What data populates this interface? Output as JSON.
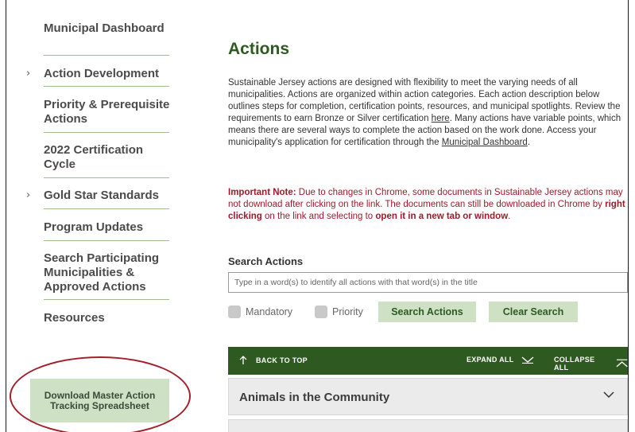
{
  "sidebar": {
    "items": [
      {
        "label": "Municipal Dashboard",
        "has_chevron": false
      },
      {
        "label": "Action Development",
        "has_chevron": true
      },
      {
        "label": "Priority & Prerequisite Actions",
        "has_chevron": false
      },
      {
        "label": "2022 Certification Cycle",
        "has_chevron": false
      },
      {
        "label": "Gold Star Standards",
        "has_chevron": true
      },
      {
        "label": "Program Updates",
        "has_chevron": false
      },
      {
        "label": "Search Participating Municipalities & Approved Actions",
        "has_chevron": false
      },
      {
        "label": "Resources",
        "has_chevron": false
      }
    ],
    "chevron_glyph": "›",
    "download_button": "Download Master Action Tracking Spreadsheet"
  },
  "main": {
    "title": "Actions",
    "intro": {
      "part1": "Sustainable Jersey actions are designed with flexibility to meet the varying needs of all municipalities. Actions are organized within action categories.  Each action description below outlines steps for completion, certification points, resources, and municipal spotlights.  Review the requirements to earn Bronze or Silver certification ",
      "link1": "here",
      "part2": ".  Many actions have variable points, which means there are several ways to complete the action based on the work done. Access your municipality's application for certification through the ",
      "link2": "Municipal Dashboard",
      "part3": "."
    },
    "note": {
      "label": "Important Note:",
      "part1": " Due to changes in Chrome, some documents in Sustainable Jersey actions may not download after clicking on the link.  The documents can still be downloaded in Chrome by ",
      "bold1": "right clicking",
      "part2": " on the link and selecting to ",
      "bold2": "open it in a new tab or window",
      "part3": "."
    },
    "search": {
      "label": "Search Actions",
      "placeholder": "Type in a word(s) to identify all actions with that word(s) in the title",
      "value": "",
      "mandatory_label": "Mandatory",
      "priority_label": "Priority",
      "search_button": "Search Actions",
      "clear_button": "Clear Search"
    },
    "toolbar": {
      "back_to_top": "BACK TO TOP",
      "expand_all": "EXPAND ALL",
      "collapse_all": "COLLAPSE ALL"
    },
    "categories": [
      {
        "label": "Animals in the Community"
      }
    ]
  },
  "colors": {
    "brand_green": "#2e5a22",
    "light_green": "#cfe1c5",
    "divider_green": "#9ebd8e",
    "alert_red": "#a01a2a",
    "annotation_red": "#a3202a"
  },
  "icons": {
    "arrow_up": "arrow-up-icon",
    "chevron_down": "chevron-down-icon",
    "collapse": "collapse-up-icon",
    "nav_chevron": "chevron-right-icon"
  }
}
